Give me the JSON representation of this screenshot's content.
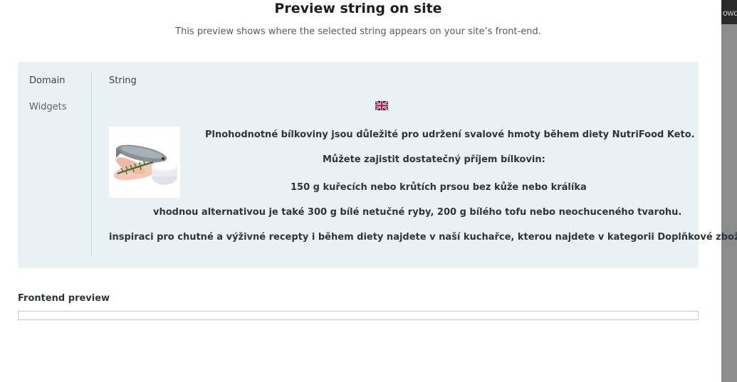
{
  "modal": {
    "title": "Preview string on site",
    "subtitle": "This preview shows where the selected string appears on your site’s front-end."
  },
  "sidebar": {
    "items": [
      {
        "label": "Domain"
      },
      {
        "label": "Widgets"
      }
    ]
  },
  "string_panel": {
    "label": "String",
    "flag_icon": "uk-flag-icon",
    "image_icon": "food-chicken-fish-cottage-cheese-image",
    "lines": [
      "Plnohodnotné bílkoviny jsou důležité pro udržení svalové hmoty během diety NutriFood Keto.",
      "Můžete zajistit dostatečný příjem bílkovin:",
      "150 g kuřecích nebo krůtích prsou bez kůže nebo králíka",
      "vhodnou alternativou je také 300 g bílé netučné ryby, 200 g bílého tofu nebo neochuceného tvarohu.",
      "inspiraci pro chutné a výživné recepty i během diety najdete v naší kuchařce, kterou najdete v kategorii Doplňkové zboží."
    ]
  },
  "frontend_preview": {
    "label": "Frontend preview"
  },
  "admin_bar": {
    "howdy_text": "owdy"
  },
  "colors": {
    "panel_bg": "#eaf1f3",
    "text": "#2f3438",
    "overlay": "#8c8c8c"
  }
}
